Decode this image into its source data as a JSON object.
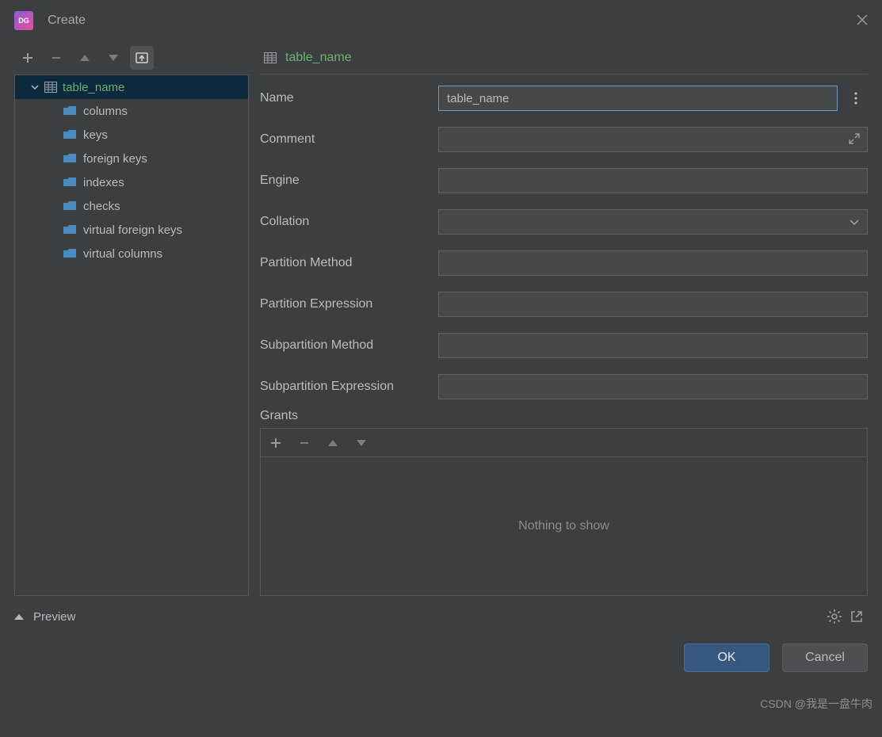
{
  "window": {
    "title": "Create",
    "app_icon_label": "DG"
  },
  "tree": {
    "root": {
      "label": "table_name"
    },
    "children": [
      {
        "label": "columns"
      },
      {
        "label": "keys"
      },
      {
        "label": "foreign keys"
      },
      {
        "label": "indexes"
      },
      {
        "label": "checks"
      },
      {
        "label": "virtual foreign keys"
      },
      {
        "label": "virtual columns"
      }
    ]
  },
  "header": {
    "label": "table_name"
  },
  "form": {
    "name": {
      "label": "Name",
      "value": "table_name"
    },
    "comment": {
      "label": "Comment",
      "value": ""
    },
    "engine": {
      "label": "Engine",
      "value": ""
    },
    "collation": {
      "label": "Collation",
      "value": ""
    },
    "partition_method": {
      "label": "Partition Method",
      "value": ""
    },
    "partition_expression": {
      "label": "Partition Expression",
      "value": ""
    },
    "subpartition_method": {
      "label": "Subpartition Method",
      "value": ""
    },
    "subpartition_expression": {
      "label": "Subpartition Expression",
      "value": ""
    }
  },
  "grants": {
    "label": "Grants",
    "empty_text": "Nothing to show"
  },
  "preview": {
    "label": "Preview"
  },
  "buttons": {
    "ok": "OK",
    "cancel": "Cancel"
  },
  "watermark": "CSDN @我是一盘牛肉"
}
